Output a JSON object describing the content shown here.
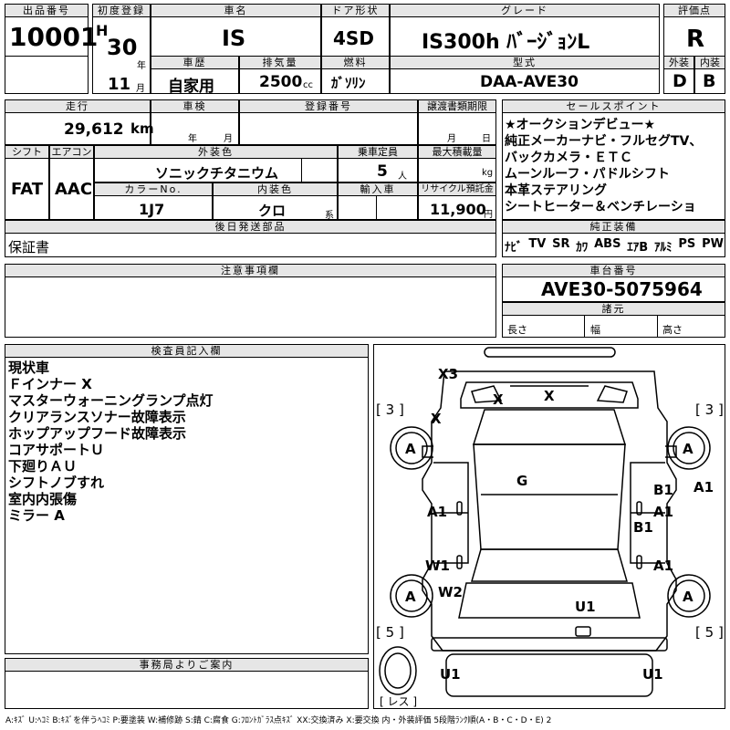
{
  "header": {
    "lot_label": "出品番号",
    "lot": "10001",
    "reg_label": "初度登録",
    "era": "H",
    "year": "30",
    "year_unit": "年",
    "month": "11",
    "month_unit": "月",
    "name_label": "車名",
    "name": "IS",
    "door_label": "ドア形状",
    "door": "4SD",
    "grade_label": "グレード",
    "grade": "IS300h ﾊﾞｰｼﾞｮﾝL",
    "score_label": "評価点",
    "score": "R",
    "history_label": "車歴",
    "history": "自家用",
    "cc_label": "排気量",
    "cc": "2500",
    "cc_unit": "cc",
    "fuel_label": "燃料",
    "fuel": "ｶﾞｿﾘﾝ",
    "model_label": "型式",
    "model": "DAA-AVE30",
    "ext_label": "外装",
    "ext": "D",
    "int_label": "内装",
    "int": "B"
  },
  "row2": {
    "mileage_label": "走行",
    "mileage": "29,612",
    "mileage_unit": "km",
    "inspect_label": "車検",
    "inspect_year": "年",
    "inspect_month": "月",
    "plate_label": "登録番号",
    "transfer_label": "譲渡書類期限",
    "transfer_month": "月",
    "transfer_day": "日",
    "shift_label": "シフト",
    "shift": "FAT",
    "ac_label": "エアコン",
    "ac": "AAC",
    "color_label": "外装色",
    "color": "ソニックチタニウム",
    "capacity_label": "乗車定員",
    "capacity": "5",
    "capacity_unit": "人",
    "load_label": "最大積載量",
    "load_unit": "kg",
    "colorno_label": "カラーNo.",
    "colorno": "1J7",
    "intcolor_label": "内装色",
    "intcolor": "クロ",
    "intcolor_unit": "系",
    "import_label": "輸入車",
    "recycle_label": "リサイクル預託金",
    "recycle": "11,900",
    "recycle_unit": "円",
    "later_label": "後日発送部品",
    "later": "保証書"
  },
  "sales": {
    "label": "セールスポイント",
    "lines": [
      "★オークションデビュー★",
      "純正メーカーナビ・フルセグTV、",
      "バックカメラ・ＥＴＣ",
      "ムーンルーフ・パドルシフト",
      "本革ステアリング",
      "シートヒーター＆ベンチレーショ"
    ],
    "equip_label": "純正装備",
    "equip": [
      "ﾅﾋﾞ",
      "TV",
      "SR",
      "ｶﾜ",
      "ABS",
      "ｴｱB",
      "ｱﾙﾐ",
      "PS",
      "PW"
    ]
  },
  "notes": {
    "label": "注意事項欄"
  },
  "chassis": {
    "label": "車台番号",
    "value": "AVE30-5075964",
    "spec_label": "諸元",
    "length": "長さ",
    "width": "幅",
    "height": "高さ"
  },
  "inspector": {
    "label": "検査員記入欄",
    "lines": [
      "現状車",
      "Ｆインナー X",
      "マスターウォーニングランプ点灯",
      "クリアランスソナー故障表示",
      "ホップアップフード故障表示",
      "コアサポートＵ",
      "下廻りＡＵ",
      "シフトノブすれ",
      "室内内張傷",
      "ミラー A"
    ]
  },
  "office": {
    "label": "事務局よりご案内"
  },
  "diagram": {
    "marks": {
      "x3": "X3",
      "x_hood": "X",
      "x1": "X",
      "x2": "X",
      "g": "G",
      "a_fl": "A",
      "a_fr": "A",
      "a_rl": "A",
      "a_rr": "A",
      "a1_l": "A1",
      "b1": "B1",
      "a1_r": "A1",
      "b1_r": "B1",
      "a1_rr": "A1",
      "a1_side": "A1",
      "w1": "W1",
      "w2": "W2",
      "u1": "U1",
      "u1_bl": "U1",
      "u1_br": "U1"
    },
    "tire_l_top": "3",
    "tire_r_top": "3",
    "tire_l_bot": "5",
    "tire_r_bot": "5",
    "spare": "レス"
  },
  "legend": "A:ｷｽﾞ U:ﾍｺﾐ B:ｷｽﾞを伴うﾍｺﾐ P:要塗装 W:補修跡 S:錆 C:腐食 G:ﾌﾛﾝﾄｶﾞﾗｽ点ｷｽﾞ XX:交換済み X:要交換 内・外装評価 5段階ﾗﾝｸ順(A・B・C・D・E) 2"
}
